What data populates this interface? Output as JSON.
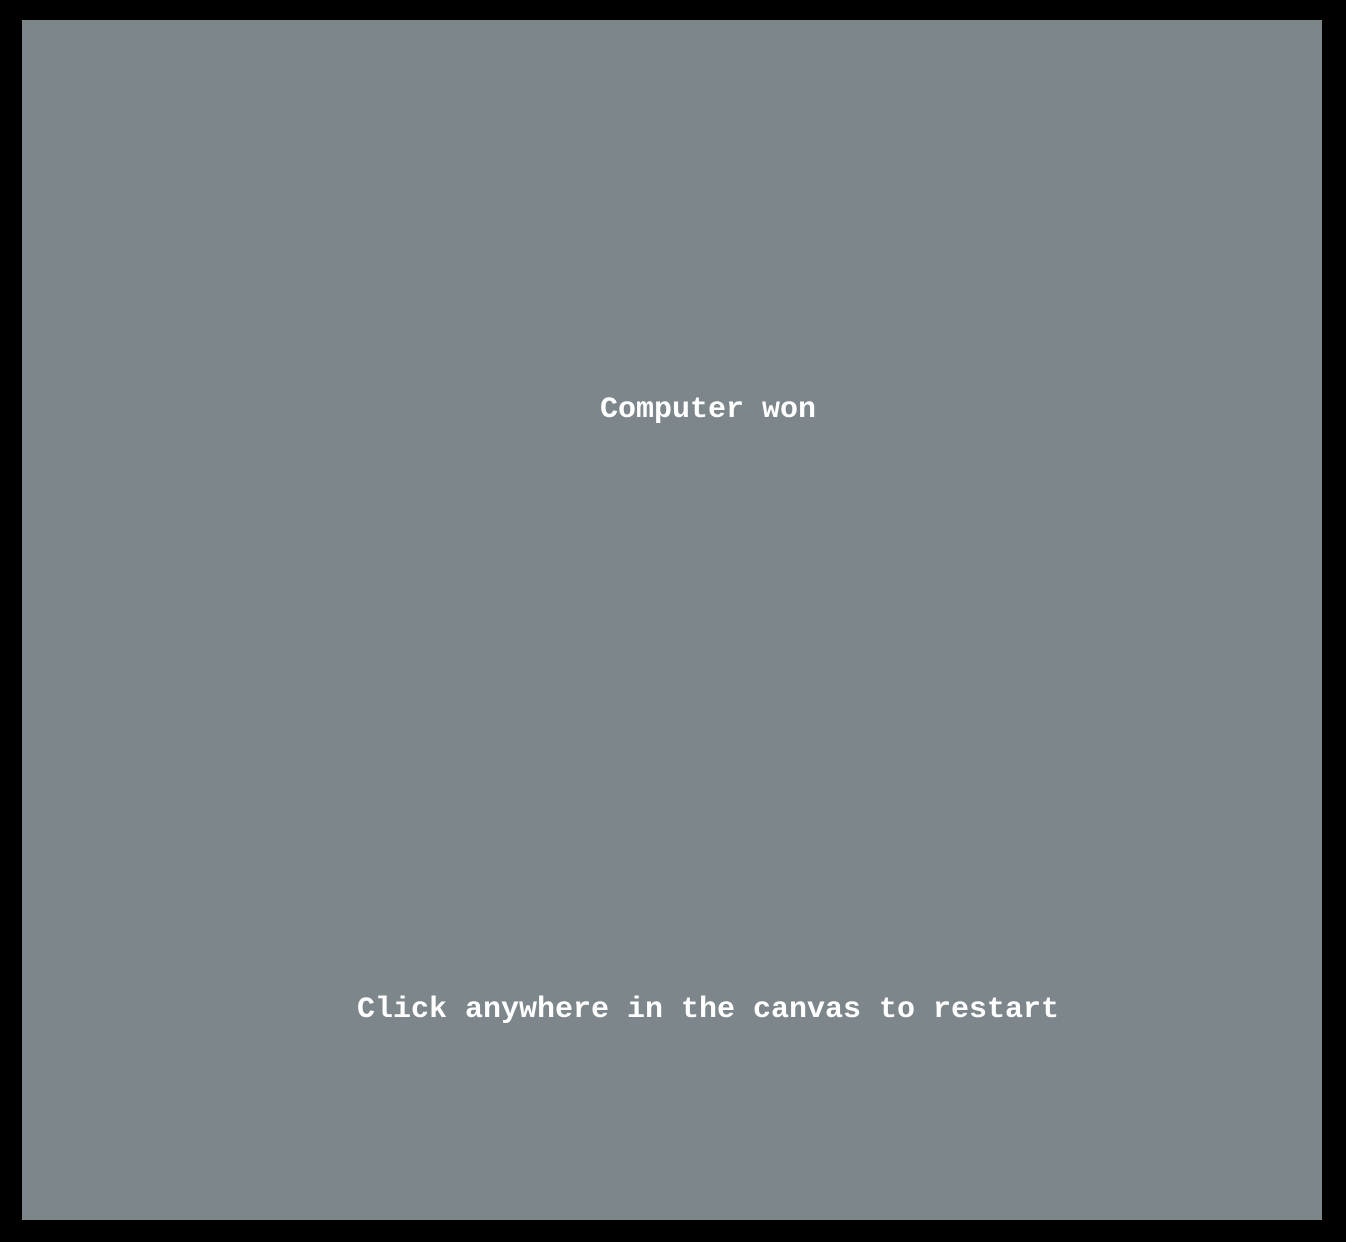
{
  "game": {
    "status_text": "Computer won",
    "restart_hint": "Click anywhere in the canvas to restart"
  },
  "colors": {
    "frame": "#000000",
    "canvas_background": "#7c868b",
    "text": "#ffffff"
  }
}
